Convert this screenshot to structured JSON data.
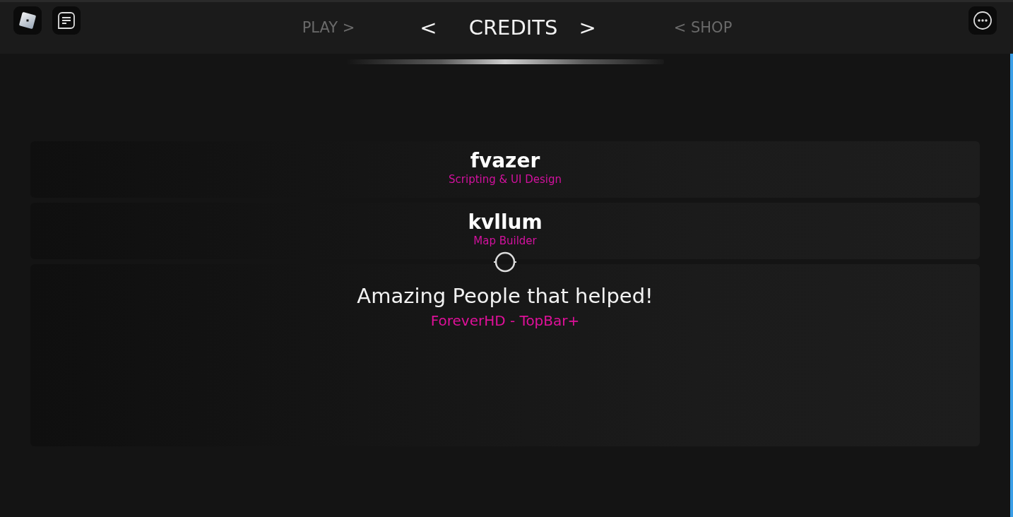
{
  "top_bar": {
    "nav": {
      "prev_arrow": "<",
      "next_arrow": ">",
      "tabs": [
        {
          "label": "PLAY >",
          "selected": false
        },
        {
          "label": "CREDITS",
          "selected": true
        },
        {
          "label": "< SHOP",
          "selected": false
        }
      ]
    }
  },
  "credits": [
    {
      "kind": "person",
      "name": "fvazer",
      "role": "Scripting & UI Design"
    },
    {
      "kind": "person",
      "name": "kvllum",
      "role": "Map Builder"
    },
    {
      "kind": "thanks",
      "title": "Amazing People that helped!",
      "entries": [
        "ForeverHD - TopBar+"
      ]
    }
  ]
}
